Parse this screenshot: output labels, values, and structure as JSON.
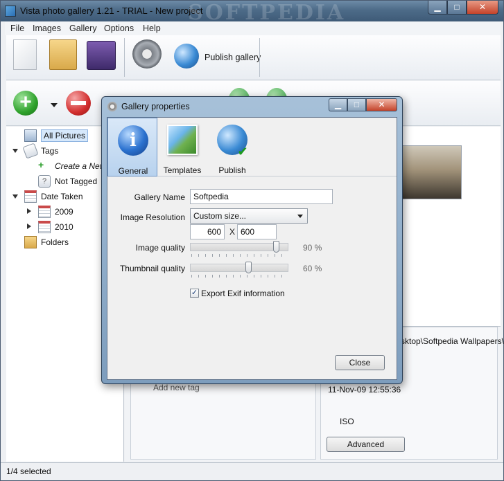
{
  "window": {
    "title": "Vista photo gallery 1.21 - TRIAL - New project",
    "watermark": "SOFTPEDIA",
    "min_glyph": "▁",
    "max_glyph": "□",
    "close_glyph": "✕"
  },
  "menu": [
    "File",
    "Images",
    "Gallery",
    "Options",
    "Help"
  ],
  "toolbar": {
    "publish_label": "Publish gallery",
    "icons": [
      "new-document-icon",
      "open-folder-icon",
      "save-disk-icon",
      "settings-gear-icon",
      "publish-globe-icon"
    ]
  },
  "toolbar2": {
    "icons": [
      "add-plus-icon",
      "dropdown-caret-icon",
      "remove-minus-icon",
      "rotate-left-icon",
      "rotate-right-icon"
    ]
  },
  "sidebar": {
    "all_pictures": "All Pictures",
    "tags": "Tags",
    "create_new": "Create a New",
    "not_tagged": "Not Tagged",
    "date_taken": "Date Taken",
    "year_2009": "2009",
    "year_2010": "2010",
    "folders": "Folders"
  },
  "info": {
    "path": "sktop\\Softpedia Wallpapers\\",
    "date": "11-Nov-09 12:55:36",
    "iso": "ISO",
    "advanced_button": "Advanced",
    "add_new_tag": "Add new tag"
  },
  "status": {
    "selected": "1/4 selected"
  },
  "dialog": {
    "title": "Gallery properties",
    "tabs": [
      {
        "label": "General",
        "icon": "info-icon",
        "active": true
      },
      {
        "label": "Templates",
        "icon": "templates-icon",
        "active": false
      },
      {
        "label": "Publish",
        "icon": "publish-globe-icon",
        "active": false
      }
    ],
    "gallery_name_label": "Gallery Name",
    "gallery_name_value": "Softpedia",
    "image_resolution_label": "Image Resolution",
    "image_resolution_value": "Custom size...",
    "width_value": "600",
    "x_label": "X",
    "height_value": "600",
    "image_quality_label": "Image quality",
    "image_quality_pct": "90 %",
    "image_quality": 90,
    "thumb_quality_label": "Thumbnail quality",
    "thumb_quality_pct": "60 %",
    "thumb_quality": 60,
    "export_exif_label": "Export Exif information",
    "export_exif_checked": true,
    "close_button": "Close"
  }
}
